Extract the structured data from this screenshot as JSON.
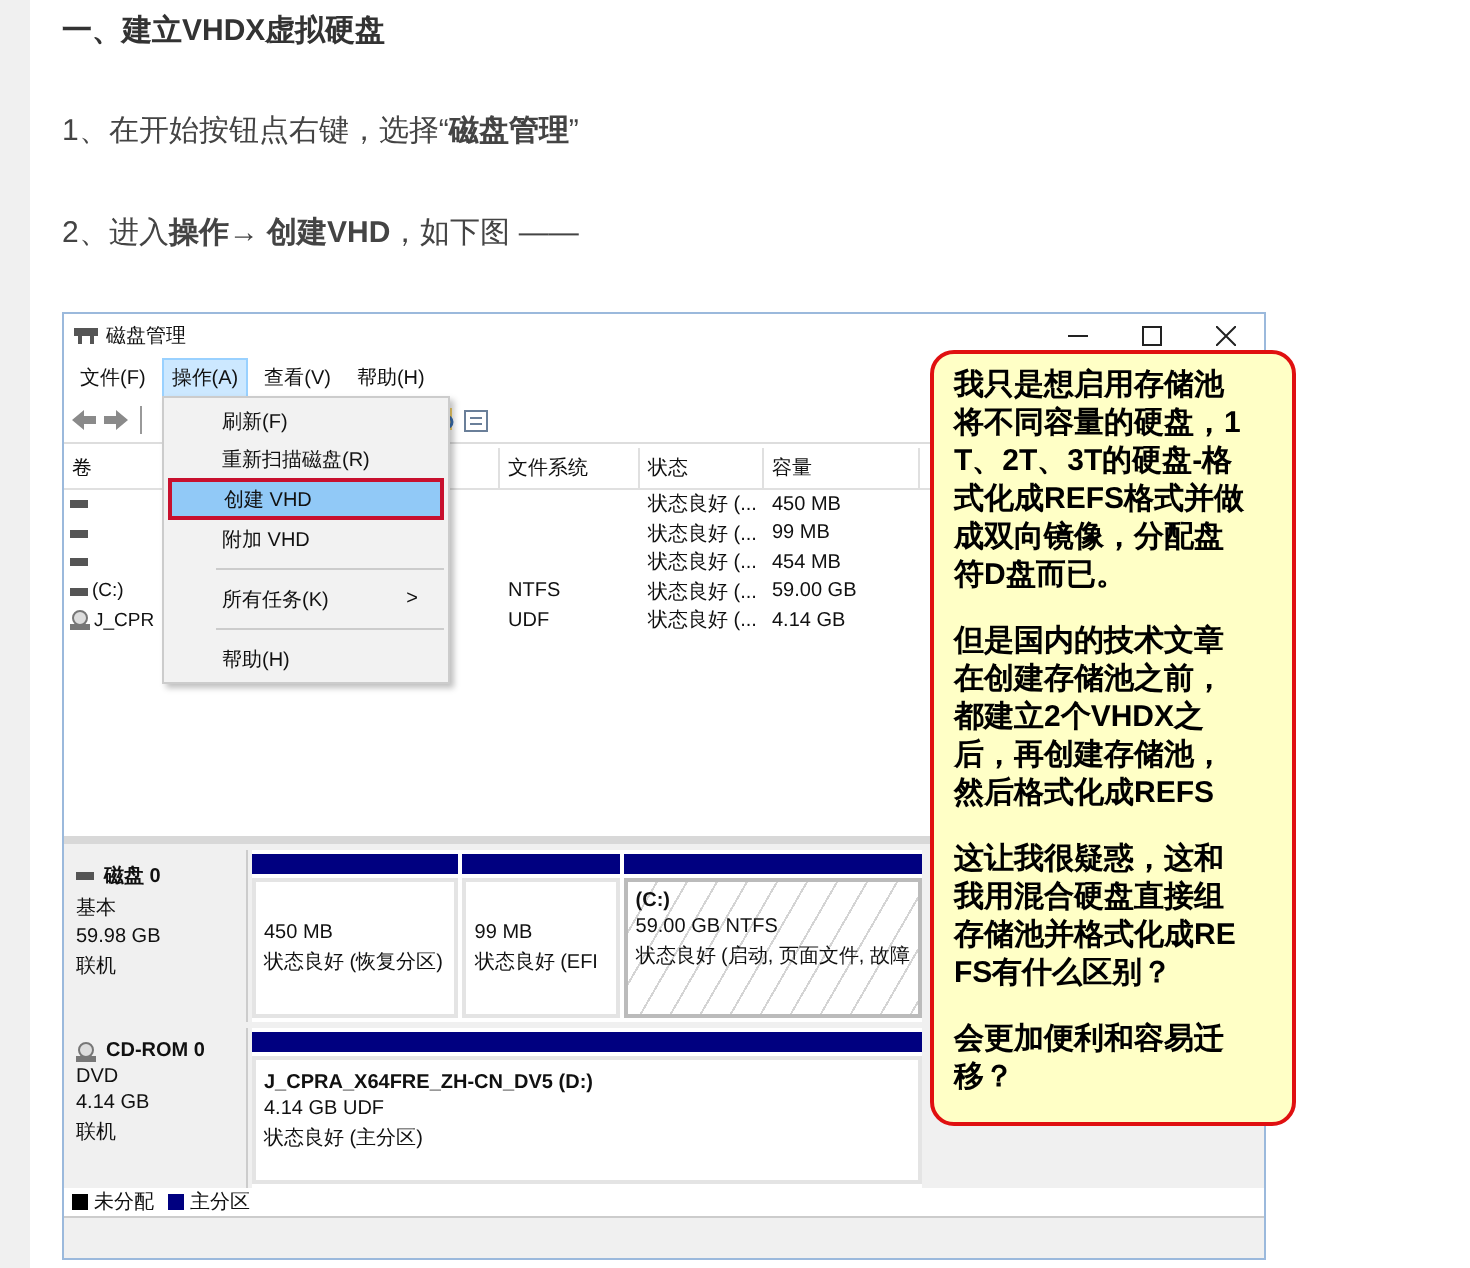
{
  "article": {
    "heading": "一、建立VHDX虚拟硬盘",
    "steps": [
      "1、在开始按钮点右键，选择“**磁盘管理**”",
      "2、进入**操作→ 创建VHD**，如下图 ——"
    ]
  },
  "window": {
    "title": "磁盘管理",
    "menu_bar": [
      {
        "label": "文件(F)",
        "selected": false
      },
      {
        "label": "操作(A)",
        "selected": true
      },
      {
        "label": "查看(V)",
        "selected": false
      },
      {
        "label": "帮助(H)",
        "selected": false
      }
    ],
    "dropdown": [
      {
        "kind": "item",
        "label": "刷新(F)",
        "selected": false
      },
      {
        "kind": "item",
        "label": "重新扫描磁盘(R)",
        "selected": false
      },
      {
        "kind": "item",
        "label": "创建 VHD",
        "selected": true
      },
      {
        "kind": "item",
        "label": "附加 VHD",
        "selected": false
      },
      {
        "kind": "separator"
      },
      {
        "kind": "submenu",
        "label": "所有任务(K)",
        "arrow": ">",
        "selected": false
      },
      {
        "kind": "separator"
      },
      {
        "kind": "item",
        "label": "帮助(H)",
        "selected": false
      }
    ],
    "table": {
      "columns": [
        "卷",
        "文件系统",
        "状态",
        "容量"
      ],
      "rows": [
        {
          "kind": "drive",
          "status": "状态良好 (...",
          "capacity": "450 MB"
        },
        {
          "kind": "drive",
          "status": "状态良好 (...",
          "capacity": "99 MB"
        },
        {
          "kind": "drive",
          "status": "状态良好 (...",
          "capacity": "454 MB"
        },
        {
          "kind": "drive",
          "volume": "(C:)",
          "filesystem": "NTFS",
          "status": "状态良好 (...",
          "capacity": "59.00 GB"
        },
        {
          "kind": "optical",
          "volume": "J_CPR",
          "filesystem": "UDF",
          "status": "状态良好 (...",
          "capacity": "4.14 GB"
        }
      ]
    },
    "disks": [
      {
        "kind": "drive",
        "name": "磁盘 0",
        "type": "基本",
        "size": "59.98 GB",
        "state": "联机",
        "partitions": [
          {
            "kind": "plain",
            "lines": [
              "450 MB",
              "状态良好 (恢复分区)"
            ]
          },
          {
            "kind": "plain",
            "lines": [
              "99 MB",
              "状态良好 (EFI"
            ]
          },
          {
            "kind": "hatched",
            "title": "(C:)",
            "lines": [
              "59.00 GB NTFS",
              "状态良好 (启动, 页面文件, 故障"
            ]
          }
        ]
      },
      {
        "kind": "optical",
        "name": "CD-ROM 0",
        "type": "DVD",
        "size": "4.14 GB",
        "state": "联机",
        "partitions": [
          {
            "kind": "plain",
            "title": "J_CPRA_X64FRE_ZH-CN_DV5  (D:)",
            "lines": [
              "4.14 GB UDF",
              "状态良好 (主分区)"
            ]
          }
        ]
      }
    ],
    "legend": [
      {
        "label": "未分配",
        "color": "#000000"
      },
      {
        "label": "主分区",
        "color": "#000080"
      }
    ]
  },
  "callout": {
    "paragraphs": [
      "我只是想启用存储池将不同容量的硬盘，1T、2T、3T的硬盘-格式化成REFS格式并做成双向镜像，分配盘符D盘而已。",
      "但是国内的技术文章在创建存储池之前，都建立2个VHDX之后，再创建存储池，然后格式化成REFS",
      "这让我很疑惑，这和我用混合硬盘直接组存储池并格式化成REFS有什么区别？",
      "会更加便利和容易迁移？"
    ]
  }
}
